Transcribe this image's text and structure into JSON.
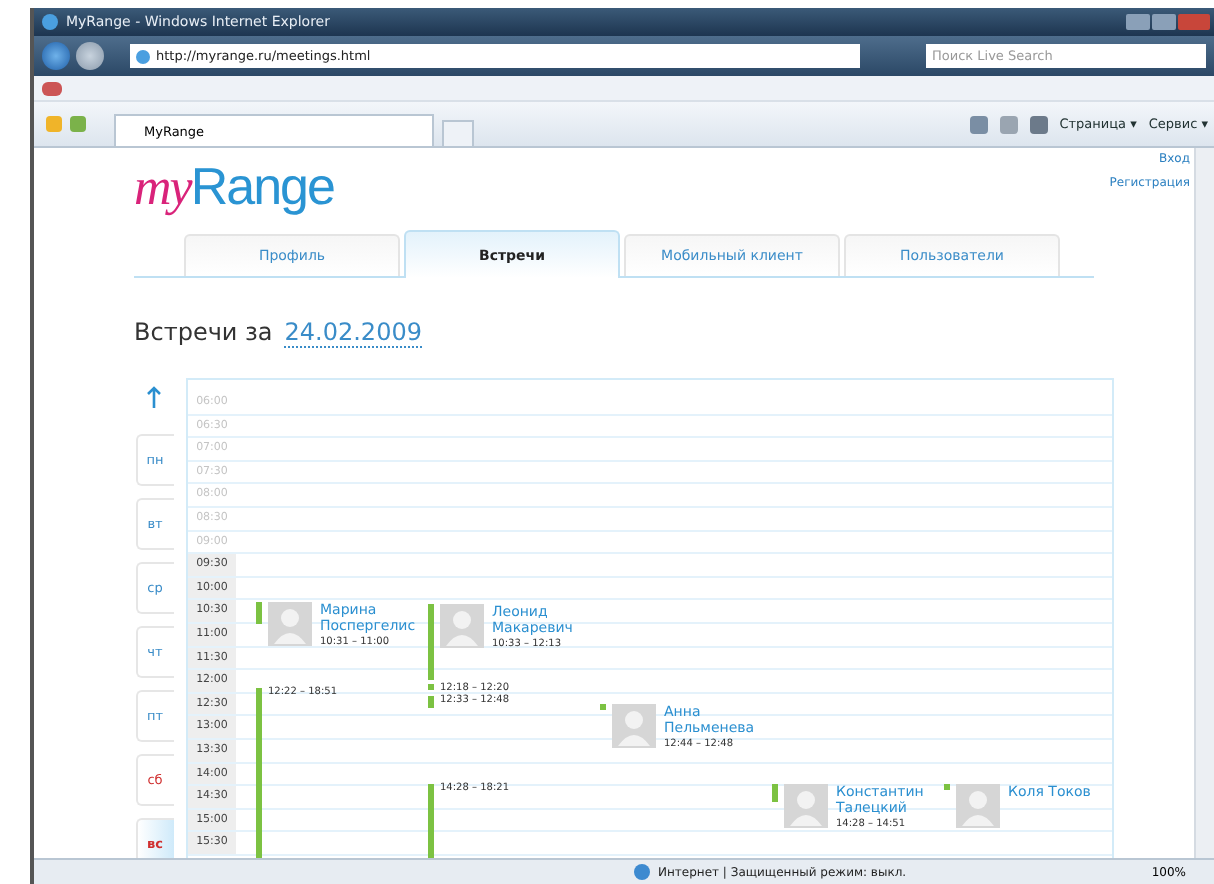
{
  "window": {
    "title": "MyRange - Windows Internet Explorer"
  },
  "address_bar": {
    "url": "http://myrange.ru/meetings.html",
    "search_placeholder": "Поиск Live Search"
  },
  "browser_tab": {
    "label": "MyRange"
  },
  "command_bar": [
    "Страница ▾",
    "Сервис ▾"
  ],
  "page": {
    "logo_prefix": "my",
    "logo_main": "Range",
    "header_links": [
      "Вход",
      "Регистрация"
    ],
    "tabs": [
      {
        "label": "Профиль",
        "selected": false
      },
      {
        "label": "Встречи",
        "selected": true
      },
      {
        "label": "Мобильный клиент",
        "selected": false
      },
      {
        "label": "Пользователи",
        "selected": false
      }
    ],
    "heading": "Встречи за",
    "date": "24.02.2009",
    "days": [
      {
        "label": "пн",
        "weekend": false,
        "selected": false
      },
      {
        "label": "вт",
        "weekend": false,
        "selected": false
      },
      {
        "label": "ср",
        "weekend": false,
        "selected": false
      },
      {
        "label": "чт",
        "weekend": false,
        "selected": false
      },
      {
        "label": "пт",
        "weekend": false,
        "selected": false
      },
      {
        "label": "сб",
        "weekend": true,
        "selected": false
      },
      {
        "label": "вс",
        "weekend": true,
        "selected": true
      }
    ],
    "hours": [
      {
        "label": "06:00",
        "faded": true
      },
      {
        "label": "06:30",
        "faded": true
      },
      {
        "label": "07:00",
        "faded": true
      },
      {
        "label": "07:30",
        "faded": true
      },
      {
        "label": "08:00",
        "faded": true
      },
      {
        "label": "08:30",
        "faded": true
      },
      {
        "label": "09:00",
        "faded": true
      },
      {
        "label": "09:30",
        "faded": false
      },
      {
        "label": "10:00",
        "faded": false
      },
      {
        "label": "10:30",
        "faded": false
      },
      {
        "label": "11:00",
        "faded": false
      },
      {
        "label": "11:30",
        "faded": false
      },
      {
        "label": "12:00",
        "faded": false
      },
      {
        "label": "12:30",
        "faded": false
      },
      {
        "label": "13:00",
        "faded": false
      },
      {
        "label": "13:30",
        "faded": false
      },
      {
        "label": "14:00",
        "faded": false
      },
      {
        "label": "14:30",
        "faded": false
      },
      {
        "label": "15:00",
        "faded": false
      },
      {
        "label": "15:30",
        "faded": false
      }
    ],
    "lanes": [
      {
        "entries": [
          {
            "kind": "person",
            "name": "Марина Поспергелис",
            "time": "10:31 – 11:00"
          },
          {
            "kind": "slot",
            "time": "12:22 – 18:51"
          }
        ]
      },
      {
        "entries": [
          {
            "kind": "person",
            "name": "Леонид Макаревич",
            "time": "10:33 – 12:13"
          },
          {
            "kind": "slot",
            "time": "12:18 – 12:20"
          },
          {
            "kind": "slot",
            "time": "12:33 – 12:48"
          },
          {
            "kind": "slot",
            "time": "14:28 – 18:21"
          }
        ]
      },
      {
        "entries": [
          {
            "kind": "person",
            "name": "Анна Пельменева",
            "time": "12:44 – 12:48"
          }
        ]
      },
      {
        "entries": [
          {
            "kind": "person",
            "name": "Константин Талецкий",
            "time": "14:28 – 14:51"
          }
        ]
      },
      {
        "entries": [
          {
            "kind": "person",
            "name": "Коля Токов"
          }
        ]
      }
    ]
  },
  "status_bar": {
    "zone": "Интернет | Защищенный режим: выкл.",
    "zoom": "100%"
  }
}
